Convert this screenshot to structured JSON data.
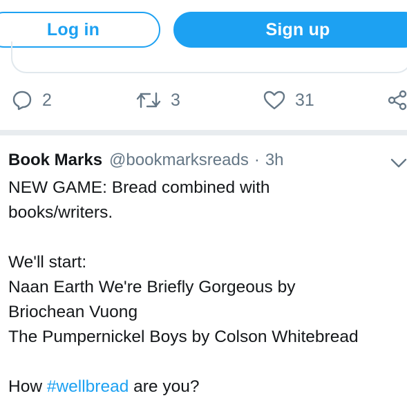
{
  "header": {
    "login_label": "Log in",
    "signup_label": "Sign up"
  },
  "actions": {
    "reply_count": "2",
    "retweet_count": "3",
    "like_count": "31"
  },
  "tweet": {
    "author": "Book Marks",
    "handle": "@bookmarksreads",
    "separator": "·",
    "time": "3h",
    "lines": [
      "NEW GAME: Bread combined with",
      "books/writers.",
      "",
      "We'll start:",
      "Naan Earth We're Briefly Gorgeous by",
      "Briochean Vuong",
      "The Pumpernickel Boys by Colson Whitebread",
      ""
    ],
    "last_line": {
      "before": "How ",
      "hashtag": "#wellbread",
      "after": " are you?"
    }
  },
  "colors": {
    "accent": "#1da1f2",
    "muted": "#657786",
    "text": "#14171a",
    "border": "#e1e8ed"
  }
}
